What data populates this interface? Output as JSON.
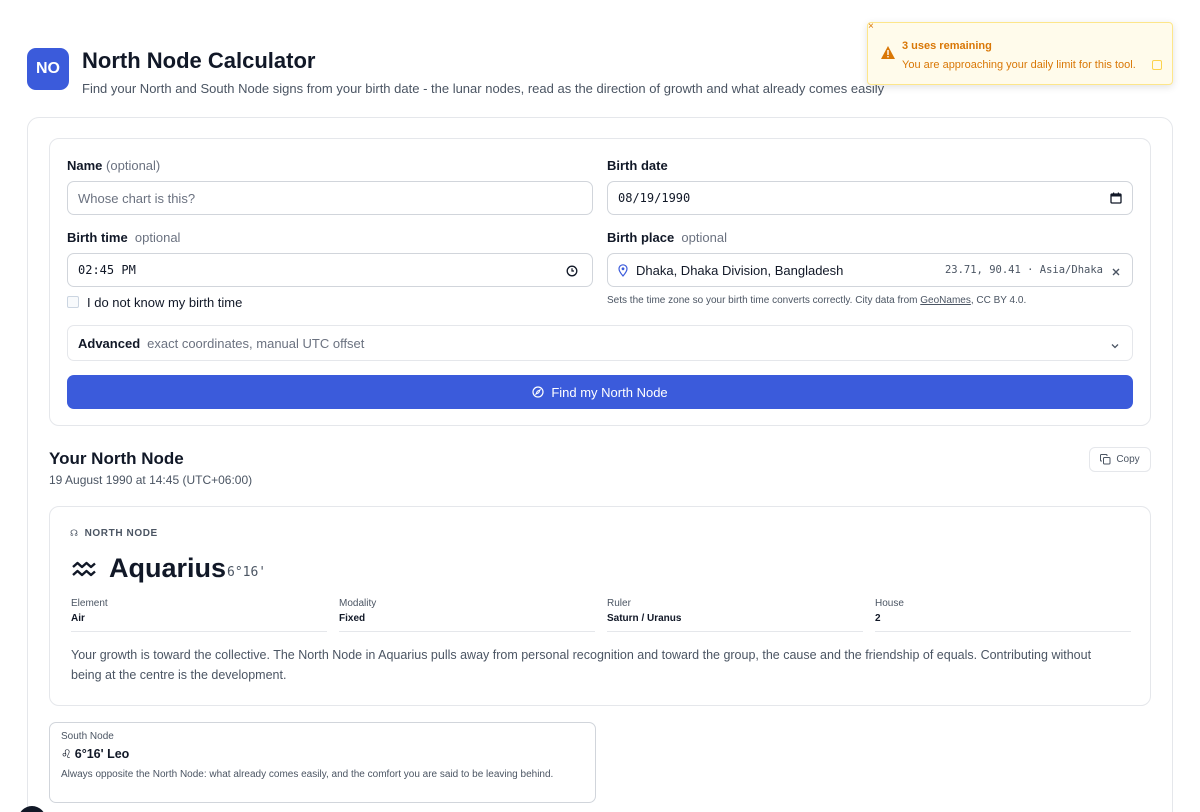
{
  "header": {
    "logo_text": "NO",
    "title": "North Node Calculator",
    "subtitle": "Find your North and South Node signs from your birth date - the lunar nodes, read as the direction of growth and what already comes easily"
  },
  "toast": {
    "close": "×",
    "title": "3 uses remaining",
    "message": "You are approaching your daily limit for this tool."
  },
  "form": {
    "name_label": "Name",
    "name_optional": "(optional)",
    "name_placeholder": "Whose chart is this?",
    "birth_date_label": "Birth date",
    "birth_date_value": "08/19/1990",
    "birth_time_label": "Birth time",
    "birth_time_optional": "optional",
    "birth_time_value": "02:45 PM",
    "unknown_time_label": "I do not know my birth time",
    "birth_place_label": "Birth place",
    "birth_place_optional": "optional",
    "birth_place_value": "Dhaka, Dhaka Division, Bangladesh",
    "birth_place_meta": "23.71, 90.41 · Asia/Dhaka",
    "birth_place_hint_prefix": "Sets the time zone so your birth time converts correctly. City data from ",
    "birth_place_hint_link": "GeoNames",
    "birth_place_hint_suffix": ", CC BY 4.0.",
    "advanced_title": "Advanced",
    "advanced_desc": "exact coordinates, manual UTC offset",
    "submit_label": "Find my North Node"
  },
  "result": {
    "title": "Your North Node",
    "subtitle": "19 August 1990 at 14:45 (UTC+06:00)",
    "copy_label": "Copy",
    "kicker": "NORTH NODE",
    "kicker_glyph": "☊",
    "sign": "Aquarius",
    "degree": "6°16'",
    "attributes": [
      {
        "key": "Element",
        "value": "Air"
      },
      {
        "key": "Modality",
        "value": "Fixed"
      },
      {
        "key": "Ruler",
        "value": "Saturn / Uranus"
      },
      {
        "key": "House",
        "value": "2"
      }
    ],
    "description": "Your growth is toward the collective. The North Node in Aquarius pulls away from personal recognition and toward the group, the cause and the friendship of equals. Contributing without being at the centre is the development."
  },
  "south": {
    "label": "South Node",
    "glyph": "♌",
    "value": "6°16' Leo",
    "description": "Always opposite the North Node: what already comes easily, and the comfort you are said to be leaving behind."
  },
  "colors": {
    "primary": "#3b5bdb",
    "warning": "#d97706",
    "warning_bg": "#fffbeb"
  },
  "icons": {
    "warning": "warning-icon",
    "clock": "clock-icon",
    "calendar": "calendar-icon",
    "location": "location-pin-icon",
    "clear": "clear-icon",
    "chevron": "chevron-down-icon",
    "compass": "compass-icon",
    "copy": "copy-icon",
    "aquarius": "aquarius-icon"
  }
}
